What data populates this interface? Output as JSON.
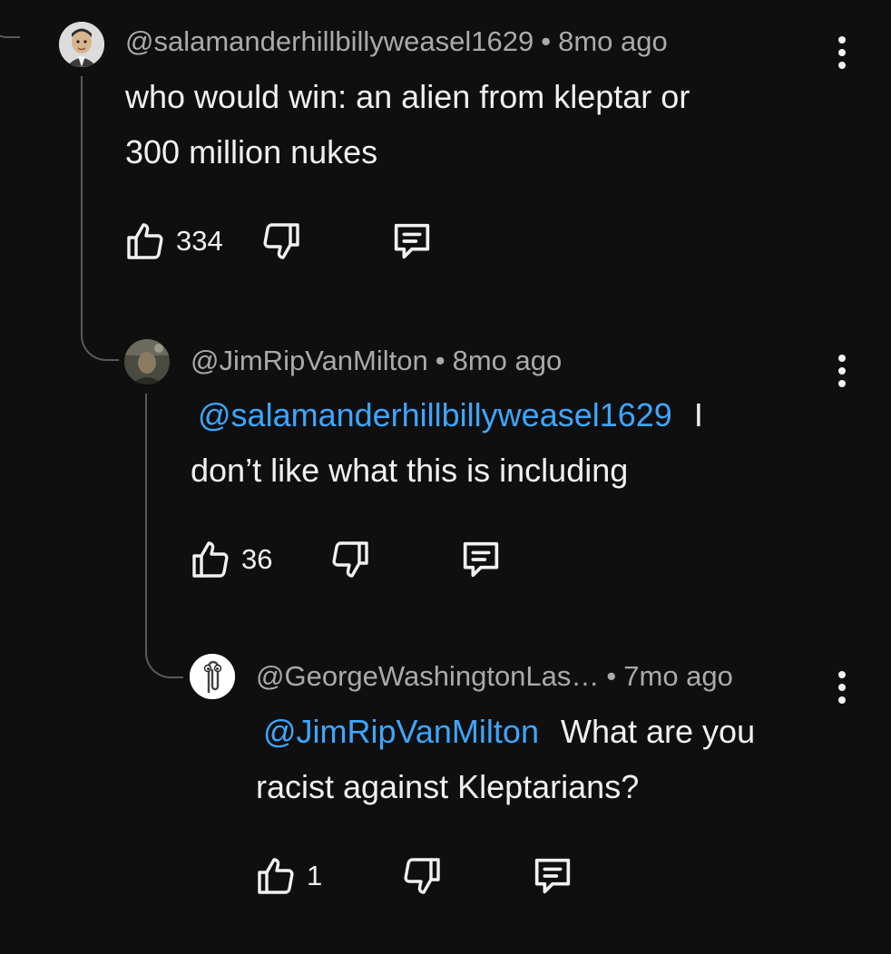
{
  "comments": [
    {
      "author": "@salamanderhillbillyweasel1629",
      "time": "8mo ago",
      "mention": "",
      "text_line1": "who would win: an alien from kleptar or",
      "text_line2": "300 million nukes",
      "likes": "334",
      "avatar_icon": "person-avatar-icon"
    },
    {
      "author": "@JimRipVanMilton",
      "time": "8mo ago",
      "mention": "@salamanderhillbillyweasel1629",
      "text_line1": "I",
      "text_line2": "don’t like what this is including",
      "likes": "36",
      "avatar_icon": "dark-photo-avatar-icon"
    },
    {
      "author": "@GeorgeWashingtonLas…",
      "time": "7mo ago",
      "mention": "@JimRipVanMilton",
      "text_line1": "What are you",
      "text_line2": "racist against Kleptarians?",
      "likes": "1",
      "avatar_icon": "paperclip-avatar-icon"
    }
  ],
  "separator": "•",
  "colors": {
    "background": "#0f0f0f",
    "text": "#f1f1f1",
    "meta": "#aaaaaa",
    "mention": "#3ea6ff",
    "thread_line": "#5a5a5a"
  }
}
